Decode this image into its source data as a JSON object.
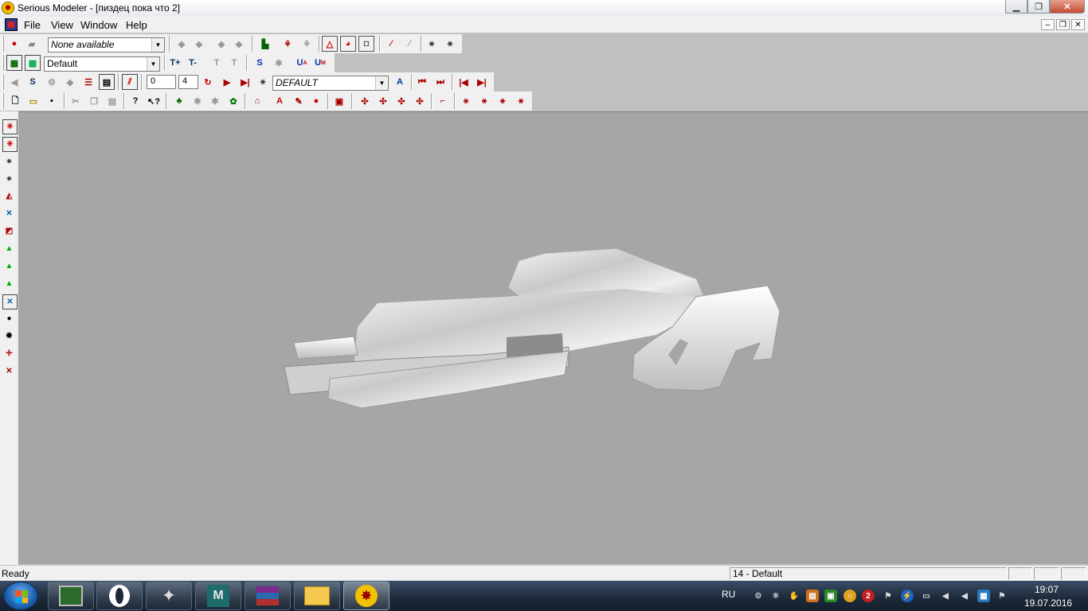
{
  "window": {
    "title": "Serious Modeler - [пиздец пока что 2]",
    "caption_buttons": [
      "minimize",
      "restore",
      "close"
    ],
    "app_icon": "serious-sam-bomb-icon"
  },
  "menu": {
    "items": [
      "File",
      "View",
      "Window",
      "Help"
    ]
  },
  "toolbar1": {
    "combo_value": "None available"
  },
  "toolbar2": {
    "combo_value": "Default",
    "text_tools": [
      "T+",
      "T-",
      "S",
      "U",
      "U"
    ]
  },
  "toolbar3": {
    "frame_start": "0",
    "frame_value": "4",
    "animation_combo": "DEFAULT"
  },
  "statusbar": {
    "status": "Ready",
    "panel_texture": "14 - Default"
  },
  "taskbar": {
    "language": "RU",
    "time": "19:07",
    "date": "19.07.2016",
    "apps": [
      "system-monitor",
      "opera",
      "game-app",
      "3ds-max",
      "winrar",
      "explorer",
      "serious-modeler"
    ],
    "tray_badge": "2"
  },
  "colors": {
    "viewport_bg": "#a6a6a6",
    "toolbar_bg": "#f0f0f0",
    "taskbar": "#1c2838"
  }
}
